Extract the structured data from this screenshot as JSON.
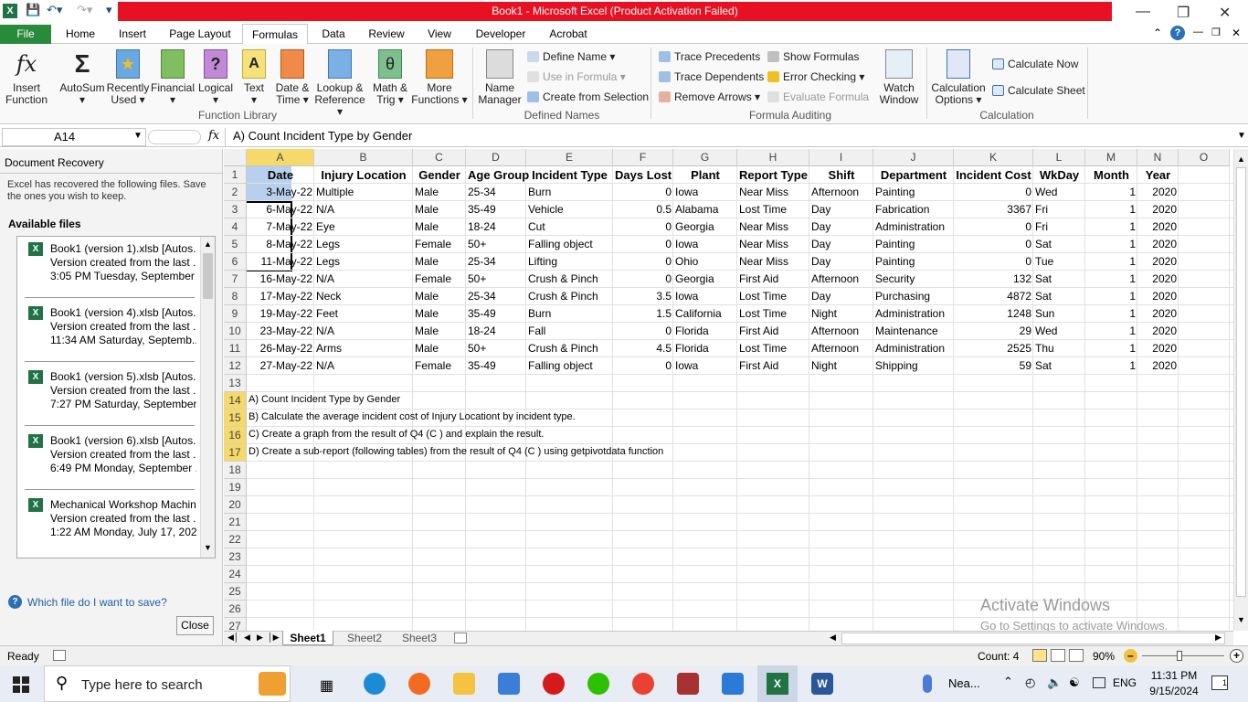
{
  "window": {
    "title": "Book1 - Microsoft Excel (Product Activation Failed)"
  },
  "tabs": [
    "File",
    "Home",
    "Insert",
    "Page Layout",
    "Formulas",
    "Data",
    "Review",
    "View",
    "Developer",
    "Acrobat"
  ],
  "ribbon": {
    "function_library": {
      "label": "Function Library",
      "buttons": [
        {
          "l1": "Insert",
          "l2": "Function",
          "icon": "insert-function-icon"
        },
        {
          "l1": "AutoSum",
          "l2": "",
          "icon": "autosum-icon"
        },
        {
          "l1": "Recently",
          "l2": "Used",
          "icon": "recently-used-icon"
        },
        {
          "l1": "Financial",
          "l2": "",
          "icon": "financial-icon"
        },
        {
          "l1": "Logical",
          "l2": "",
          "icon": "logical-icon"
        },
        {
          "l1": "Text",
          "l2": "",
          "icon": "text-icon"
        },
        {
          "l1": "Date &",
          "l2": "Time",
          "icon": "date-time-icon"
        },
        {
          "l1": "Lookup &",
          "l2": "Reference",
          "icon": "lookup-reference-icon"
        },
        {
          "l1": "Math &",
          "l2": "Trig",
          "icon": "math-trig-icon"
        },
        {
          "l1": "More",
          "l2": "Functions",
          "icon": "more-functions-icon"
        }
      ]
    },
    "defined_names": {
      "label": "Defined Names",
      "manager_l1": "Name",
      "manager_l2": "Manager",
      "define": "Define Name",
      "use": "Use in Formula",
      "create": "Create from Selection"
    },
    "formula_auditing": {
      "label": "Formula Auditing",
      "trace_prec": "Trace Precedents",
      "trace_dep": "Trace Dependents",
      "remove": "Remove Arrows",
      "show": "Show Formulas",
      "error": "Error Checking",
      "evaluate": "Evaluate Formula",
      "watch_l1": "Watch",
      "watch_l2": "Window"
    },
    "calculation": {
      "label": "Calculation",
      "options_l1": "Calculation",
      "options_l2": "Options",
      "now": "Calculate Now",
      "sheet": "Calculate Sheet"
    }
  },
  "formula_bar": {
    "name_box": "A14",
    "fx": "fx",
    "formula": "A) Count Incident Type by Gender"
  },
  "recovery": {
    "title": "Document Recovery",
    "desc": "Excel has recovered the following files.  Save the ones you wish to keep.",
    "available": "Available files",
    "files": [
      {
        "name": "Book1 (version 1).xlsb  [Autos...",
        "line2": "Version created from the last ...",
        "line3": "3:05 PM Tuesday, September ..."
      },
      {
        "name": "Book1 (version 4).xlsb  [Autos...",
        "line2": "Version created from the last ...",
        "line3": "11:34 AM Saturday, Septemb..."
      },
      {
        "name": "Book1 (version 5).xlsb  [Autos...",
        "line2": "Version created from the last ...",
        "line3": "7:27 PM Saturday, September..."
      },
      {
        "name": "Book1 (version 6).xlsb  [Autos...",
        "line2": "Version created from the last ...",
        "line3": "6:49 PM Monday, September ..."
      },
      {
        "name": "Mechanical Workshop Machine...",
        "line2": "Version created from the last ...",
        "line3": "1:22 AM Monday, July 17, 2023"
      }
    ],
    "help": "Which file do I want to save?",
    "close": "Close"
  },
  "sheet": {
    "columns": [
      "A",
      "B",
      "C",
      "D",
      "E",
      "F",
      "G",
      "H",
      "I",
      "J",
      "K",
      "L",
      "M",
      "N",
      "O"
    ],
    "headers": [
      "Date",
      "Injury Location",
      "Gender",
      "Age Group",
      "Incident Type",
      "Days Lost",
      "Plant",
      "Report Type",
      "Shift",
      "Department",
      "Incident Cost",
      "WkDay",
      "Month",
      "Year"
    ],
    "rows": [
      [
        "3-May-22",
        "Multiple",
        "Male",
        "25-34",
        "Burn",
        "0",
        "Iowa",
        "Near Miss",
        "Afternoon",
        "Painting",
        "0",
        "Wed",
        "1",
        "2020"
      ],
      [
        "6-May-22",
        "N/A",
        "Male",
        "35-49",
        "Vehicle",
        "0.5",
        "Alabama",
        "Lost Time",
        "Day",
        "Fabrication",
        "3367",
        "Fri",
        "1",
        "2020"
      ],
      [
        "7-May-22",
        "Eye",
        "Male",
        "18-24",
        "Cut",
        "0",
        "Georgia",
        "Near Miss",
        "Day",
        "Administration",
        "0",
        "Fri",
        "1",
        "2020"
      ],
      [
        "8-May-22",
        "Legs",
        "Female",
        "50+",
        "Falling object",
        "0",
        "Iowa",
        "Near Miss",
        "Day",
        "Painting",
        "0",
        "Sat",
        "1",
        "2020"
      ],
      [
        "11-May-22",
        "Legs",
        "Male",
        "25-34",
        "Lifting",
        "0",
        "Ohio",
        "Near Miss",
        "Day",
        "Painting",
        "0",
        "Tue",
        "1",
        "2020"
      ],
      [
        "16-May-22",
        "N/A",
        "Female",
        "50+",
        "Crush & Pinch",
        "0",
        "Georgia",
        "First Aid",
        "Afternoon",
        "Security",
        "132",
        "Sat",
        "1",
        "2020"
      ],
      [
        "17-May-22",
        "Neck",
        "Male",
        "25-34",
        "Crush & Pinch",
        "3.5",
        "Iowa",
        "Lost Time",
        "Day",
        "Purchasing",
        "4872",
        "Sat",
        "1",
        "2020"
      ],
      [
        "19-May-22",
        "Feet",
        "Male",
        "35-49",
        "Burn",
        "1.5",
        "California",
        "Lost Time",
        "Night",
        "Administration",
        "1248",
        "Sun",
        "1",
        "2020"
      ],
      [
        "23-May-22",
        "N/A",
        "Male",
        "18-24",
        "Fall",
        "0",
        "Florida",
        "First Aid",
        "Afternoon",
        "Maintenance",
        "29",
        "Wed",
        "1",
        "2020"
      ],
      [
        "26-May-22",
        "Arms",
        "Male",
        "50+",
        "Crush & Pinch",
        "4.5",
        "Florida",
        "Lost Time",
        "Afternoon",
        "Administration",
        "2525",
        "Thu",
        "1",
        "2020"
      ],
      [
        "27-May-22",
        "N/A",
        "Female",
        "35-49",
        "Falling object",
        "0",
        "Iowa",
        "First Aid",
        "Night",
        "Shipping",
        "59",
        "Sat",
        "1",
        "2020"
      ]
    ],
    "notes": [
      "A) Count Incident Type by Gender",
      "B) Calculate the average incident cost of Injury Locationt by incident type.",
      "C) Create a graph from the result of Q4 (C ) and explain the result.",
      "D) Create a sub-report (following tables) from the result of Q4 (C ) using getpivotdata function"
    ],
    "row_numbers": [
      "1",
      "2",
      "3",
      "4",
      "5",
      "6",
      "7",
      "8",
      "9",
      "10",
      "11",
      "12",
      "13",
      "14",
      "15",
      "16",
      "17",
      "18",
      "19",
      "20",
      "21",
      "22",
      "23",
      "24",
      "25",
      "26",
      "27",
      "28"
    ]
  },
  "sheet_tabs": [
    "Sheet1",
    "Sheet2",
    "Sheet3"
  ],
  "status": {
    "ready": "Ready",
    "count": "Count: 4",
    "zoom": "90%"
  },
  "watermark": {
    "l1": "Activate Windows",
    "l2": "Go to Settings to activate Windows."
  },
  "taskbar": {
    "search": "Type here to search",
    "weather": "Nea...",
    "lang": "ENG",
    "time": "11:31 PM",
    "date": "9/15/2024",
    "notif": "1"
  }
}
